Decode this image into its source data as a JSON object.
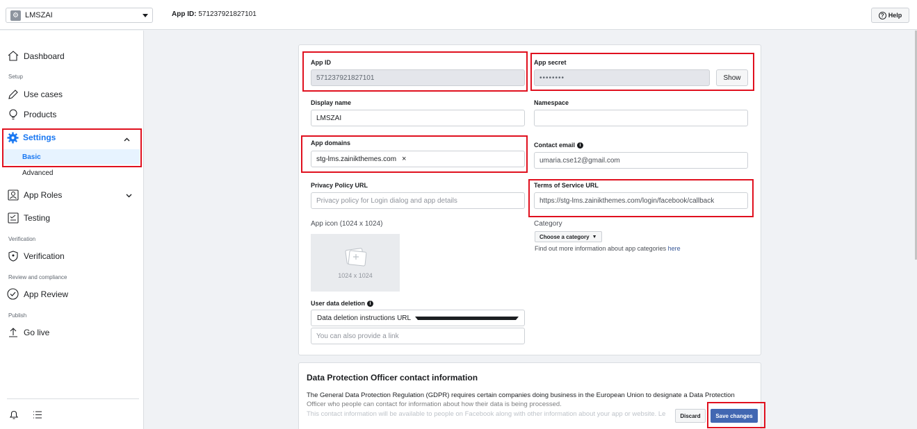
{
  "topbar": {
    "app_name": "LMSZAI",
    "app_id_label": "App ID:",
    "app_id_value": "571237921827101",
    "help_label": "Help"
  },
  "sidebar": {
    "dashboard": "Dashboard",
    "section_setup": "Setup",
    "use_cases": "Use cases",
    "products": "Products",
    "settings": "Settings",
    "basic": "Basic",
    "advanced": "Advanced",
    "app_roles": "App Roles",
    "testing": "Testing",
    "section_verification": "Verification",
    "verification": "Verification",
    "section_review": "Review and compliance",
    "app_review": "App Review",
    "section_publish": "Publish",
    "go_live": "Go live"
  },
  "form": {
    "app_id_label": "App ID",
    "app_id_value": "571237921827101",
    "app_secret_label": "App secret",
    "app_secret_value": "••••••••",
    "show_label": "Show",
    "display_name_label": "Display name",
    "display_name_value": "LMSZAI",
    "namespace_label": "Namespace",
    "namespace_value": "",
    "app_domains_label": "App domains",
    "app_domain_chip": "stg-lms.zainikthemes.com",
    "contact_email_label": "Contact email",
    "contact_email_value": "umaria.cse12@gmail.com",
    "privacy_label": "Privacy Policy URL",
    "privacy_placeholder": "Privacy policy for Login dialog and app details",
    "tos_label": "Terms of Service URL",
    "tos_value": "https://stg-lms.zainikthemes.com/login/facebook/callback",
    "app_icon_label": "App icon (1024 x 1024)",
    "app_icon_size": "1024 x 1024",
    "category_label": "Category",
    "category_button": "Choose a category",
    "category_help": "Find out more information about app categories",
    "category_help_link": "here",
    "user_data_label": "User data deletion",
    "user_data_select": "Data deletion instructions URL",
    "user_data_placeholder": "You can also provide a link"
  },
  "dpo": {
    "title": "Data Protection Officer contact information",
    "text1": "The General Data Protection Regulation (GDPR) requires certain companies doing business in the European Union to designate a Data Protection Officer who people can contact for information about how their data is being processed.",
    "text2": "This contact information will be available to people on Facebook along with other information about your app or website. Le"
  },
  "actions": {
    "discard": "Discard",
    "save": "Save changes"
  },
  "colors": {
    "accent": "#1877f2",
    "highlight": "#e0101e",
    "primary_button": "#4267b2"
  }
}
